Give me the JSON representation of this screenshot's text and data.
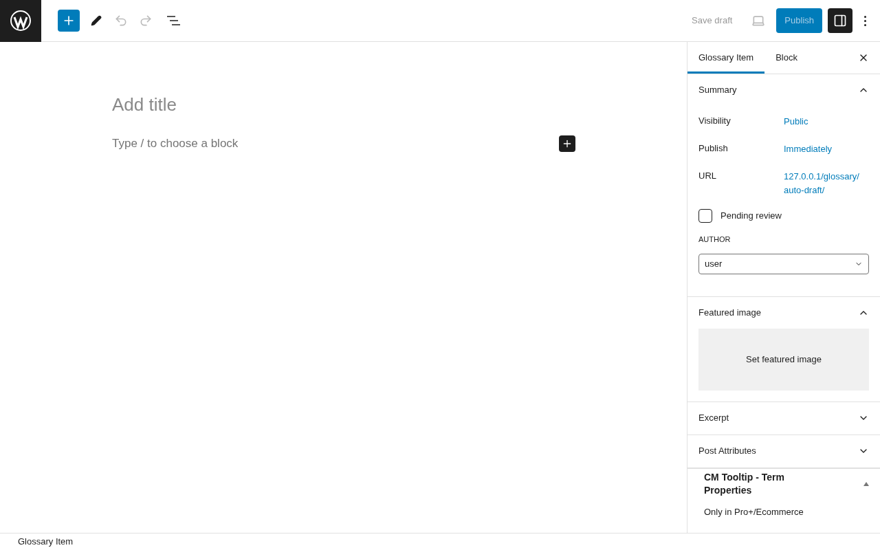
{
  "toolbar": {
    "save_draft": "Save draft",
    "publish": "Publish",
    "settings_pressed": true
  },
  "editor": {
    "title_placeholder": "Add title",
    "block_placeholder": "Type / to choose a block"
  },
  "sidebar": {
    "tabs": [
      {
        "label": "Glossary Item",
        "selected": true
      },
      {
        "label": "Block",
        "selected": false
      }
    ],
    "summary": {
      "title": "Summary",
      "expanded": true,
      "rows": [
        {
          "label": "Visibility",
          "value": "Public"
        },
        {
          "label": "Publish",
          "value": "Immediately"
        },
        {
          "label": "URL",
          "value": "127.0.0.1/glossary/ auto-draft/"
        }
      ],
      "pending_review": {
        "label": "Pending review",
        "checked": false
      },
      "author": {
        "label": "AUTHOR",
        "value": "user"
      }
    },
    "featured_image": {
      "title": "Featured image",
      "expanded": true,
      "button": "Set featured image"
    },
    "collapsed_panels": [
      {
        "title": "Excerpt",
        "expanded": false
      },
      {
        "title": "Post Attributes",
        "expanded": false
      }
    ],
    "cm_tooltip": {
      "title": "CM Tooltip - Term Properties",
      "expanded": true,
      "note": "Only in Pro+/Ecommerce"
    }
  },
  "footer": {
    "breadcrumb": "Glossary Item"
  }
}
